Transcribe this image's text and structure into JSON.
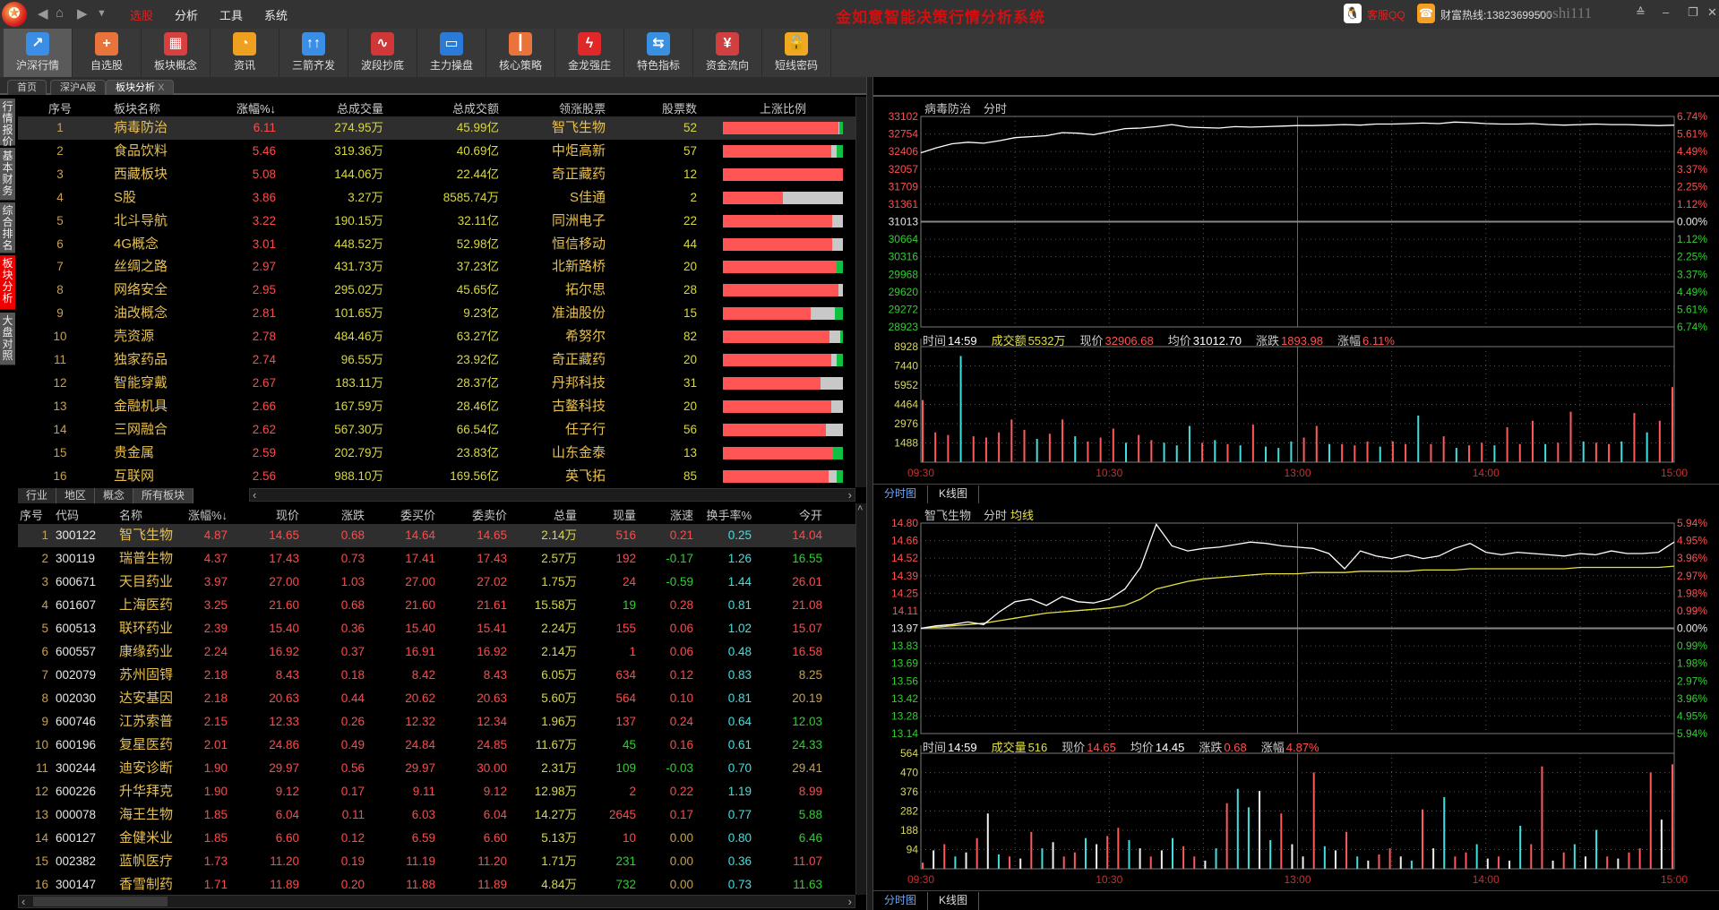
{
  "app": {
    "title": "金如意智能决策行情分析系统",
    "logo": "如意",
    "service_qq": "客服QQ",
    "hotline": "财富热线:13823699500",
    "user": "ceshi111"
  },
  "menu": [
    "选股",
    "分析",
    "工具",
    "系统"
  ],
  "toolbar": [
    {
      "label": "沪深行情",
      "icon": "chart-up-icon",
      "glyph": "↗",
      "color": "#3a8ee6"
    },
    {
      "label": "自选股",
      "icon": "plus-icon",
      "glyph": "+",
      "color": "#e8743b"
    },
    {
      "label": "板块概念",
      "icon": "grid-icon",
      "glyph": "▦",
      "color": "#d84040"
    },
    {
      "label": "资讯",
      "icon": "rss-icon",
      "glyph": "◔",
      "color": "#f0a020"
    },
    {
      "label": "三箭齐发",
      "icon": "arrows-up-icon",
      "glyph": "↑↑",
      "color": "#3a8ee6"
    },
    {
      "label": "波段抄底",
      "icon": "wave-icon",
      "glyph": "∿",
      "color": "#d03838"
    },
    {
      "label": "主力操盘",
      "icon": "monitor-chart-icon",
      "glyph": "▭",
      "color": "#2a7ad8"
    },
    {
      "label": "核心策略",
      "icon": "candles-icon",
      "glyph": "┃",
      "color": "#e8743b"
    },
    {
      "label": "金龙强庄",
      "icon": "zigzag-icon",
      "glyph": "ϟ",
      "color": "#e02828"
    },
    {
      "label": "特色指标",
      "icon": "signpost-icon",
      "glyph": "⇆",
      "color": "#3a90e0"
    },
    {
      "label": "资金流向",
      "icon": "money-icon",
      "glyph": "¥",
      "color": "#d04040"
    },
    {
      "label": "短线密码",
      "icon": "lock-icon",
      "glyph": "🔓",
      "color": "#f0a820"
    }
  ],
  "page_tabs": [
    "首页",
    "深沪A股",
    "板块分析"
  ],
  "page_tab_close": "X",
  "side_tabs": [
    "行情报价",
    "基本财务",
    "综合排名",
    "板块分析",
    "大盘对照"
  ],
  "sector_table": {
    "headers": [
      "序号",
      "板块名称",
      "涨幅%↓",
      "总成交量",
      "总成交额",
      "领涨股票",
      "股票数",
      "上涨比例"
    ],
    "rows": [
      [
        "1",
        "病毒防治",
        "6.11",
        "274.95万",
        "45.99亿",
        "智飞生物",
        "52"
      ],
      [
        "2",
        "食品饮料",
        "5.46",
        "319.36万",
        "40.69亿",
        "中炬高新",
        "57"
      ],
      [
        "3",
        "西藏板块",
        "5.08",
        "144.06万",
        "22.44亿",
        "奇正藏药",
        "12"
      ],
      [
        "4",
        "S股",
        "3.86",
        "3.27万",
        "8585.74万",
        "S佳通",
        "2"
      ],
      [
        "5",
        "北斗导航",
        "3.22",
        "190.15万",
        "32.11亿",
        "同洲电子",
        "22"
      ],
      [
        "6",
        "4G概念",
        "3.01",
        "448.52万",
        "52.98亿",
        "恒信移动",
        "44"
      ],
      [
        "7",
        "丝绸之路",
        "2.97",
        "431.73万",
        "37.23亿",
        "北新路桥",
        "20"
      ],
      [
        "8",
        "网络安全",
        "2.95",
        "295.02万",
        "45.65亿",
        "拓尔思",
        "28"
      ],
      [
        "9",
        "油改概念",
        "2.81",
        "101.65万",
        "9.23亿",
        "准油股份",
        "15"
      ],
      [
        "10",
        "壳资源",
        "2.78",
        "484.46万",
        "63.27亿",
        "希努尔",
        "82"
      ],
      [
        "11",
        "独家药品",
        "2.74",
        "96.55万",
        "23.92亿",
        "奇正藏药",
        "20"
      ],
      [
        "12",
        "智能穿戴",
        "2.67",
        "183.11万",
        "28.37亿",
        "丹邦科技",
        "31"
      ],
      [
        "13",
        "金融机具",
        "2.66",
        "167.59万",
        "28.46亿",
        "古鳌科技",
        "20"
      ],
      [
        "14",
        "三网融合",
        "2.62",
        "567.30万",
        "66.54亿",
        "任子行",
        "56"
      ],
      [
        "15",
        "贵金属",
        "2.59",
        "202.79万",
        "23.83亿",
        "山东金泰",
        "13"
      ],
      [
        "16",
        "互联网",
        "2.56",
        "988.10万",
        "169.56亿",
        "英飞拓",
        "85"
      ]
    ],
    "ratios": [
      [
        0.96,
        0.01,
        0.03
      ],
      [
        0.9,
        0.05,
        0.05
      ],
      [
        1,
        0,
        0
      ],
      [
        0.5,
        0.5,
        0
      ],
      [
        0.91,
        0.09,
        0
      ],
      [
        0.91,
        0.09,
        0
      ],
      [
        0.95,
        0,
        0.05
      ],
      [
        0.96,
        0.04,
        0
      ],
      [
        0.73,
        0.2,
        0.07
      ],
      [
        0.89,
        0.09,
        0.02
      ],
      [
        0.9,
        0.05,
        0.05
      ],
      [
        0.81,
        0.19,
        0
      ],
      [
        0.9,
        0.1,
        0
      ],
      [
        0.86,
        0.14,
        0
      ],
      [
        0.92,
        0,
        0.08
      ],
      [
        0.88,
        0.07,
        0.05
      ]
    ]
  },
  "sector_tabs": [
    "行业",
    "地区",
    "概念",
    "所有板块"
  ],
  "stock_table": {
    "headers": [
      "序号",
      "代码",
      "名称",
      "涨幅%↓",
      "现价",
      "涨跌",
      "委买价",
      "委卖价",
      "总量",
      "现量",
      "涨速",
      "换手率%",
      "今开"
    ],
    "rows": [
      [
        "1",
        "300122",
        "智飞生物",
        "4.87",
        "14.65",
        "0.68",
        "14.64",
        "14.65",
        "2.14万",
        "516",
        "0.21",
        "0.25",
        "14.04"
      ],
      [
        "2",
        "300119",
        "瑞普生物",
        "4.37",
        "17.43",
        "0.73",
        "17.41",
        "17.43",
        "2.57万",
        "192",
        "-0.17",
        "1.26",
        "16.55"
      ],
      [
        "3",
        "600671",
        "天目药业",
        "3.97",
        "27.00",
        "1.03",
        "27.00",
        "27.02",
        "1.75万",
        "24",
        "-0.59",
        "1.44",
        "26.01"
      ],
      [
        "4",
        "601607",
        "上海医药",
        "3.25",
        "21.60",
        "0.68",
        "21.60",
        "21.61",
        "15.58万",
        "19",
        "0.28",
        "0.81",
        "21.08"
      ],
      [
        "5",
        "600513",
        "联环药业",
        "2.39",
        "15.40",
        "0.36",
        "15.40",
        "15.41",
        "2.24万",
        "155",
        "0.06",
        "1.02",
        "15.07"
      ],
      [
        "6",
        "600557",
        "康缘药业",
        "2.24",
        "16.92",
        "0.37",
        "16.91",
        "16.92",
        "2.14万",
        "1",
        "0.06",
        "0.48",
        "16.58"
      ],
      [
        "7",
        "002079",
        "苏州固锝",
        "2.18",
        "8.43",
        "0.18",
        "8.42",
        "8.43",
        "6.05万",
        "634",
        "0.12",
        "0.83",
        "8.25"
      ],
      [
        "8",
        "002030",
        "达安基因",
        "2.18",
        "20.63",
        "0.44",
        "20.62",
        "20.63",
        "5.60万",
        "564",
        "0.10",
        "0.81",
        "20.19"
      ],
      [
        "9",
        "600746",
        "江苏索普",
        "2.15",
        "12.33",
        "0.26",
        "12.32",
        "12.34",
        "1.96万",
        "137",
        "0.24",
        "0.64",
        "12.03"
      ],
      [
        "10",
        "600196",
        "复星医药",
        "2.01",
        "24.86",
        "0.49",
        "24.84",
        "24.85",
        "11.67万",
        "45",
        "0.16",
        "0.61",
        "24.33"
      ],
      [
        "11",
        "300244",
        "迪安诊断",
        "1.90",
        "29.97",
        "0.56",
        "29.97",
        "30.00",
        "2.31万",
        "109",
        "-0.03",
        "0.70",
        "29.41"
      ],
      [
        "12",
        "600226",
        "升华拜克",
        "1.90",
        "9.12",
        "0.17",
        "9.11",
        "9.12",
        "12.98万",
        "2",
        "0.22",
        "1.19",
        "8.99"
      ],
      [
        "13",
        "000078",
        "海王生物",
        "1.85",
        "6.04",
        "0.11",
        "6.03",
        "6.04",
        "14.27万",
        "2645",
        "0.17",
        "0.77",
        "5.88"
      ],
      [
        "14",
        "600127",
        "金健米业",
        "1.85",
        "6.60",
        "0.12",
        "6.59",
        "6.60",
        "5.13万",
        "10",
        "0.00",
        "0.80",
        "6.46"
      ],
      [
        "15",
        "002382",
        "蓝帆医疗",
        "1.73",
        "11.20",
        "0.19",
        "11.19",
        "11.20",
        "1.71万",
        "231",
        "0.00",
        "0.36",
        "11.07"
      ],
      [
        "16",
        "300147",
        "香雪制药",
        "1.71",
        "11.89",
        "0.20",
        "11.88",
        "11.89",
        "4.84万",
        "732",
        "0.00",
        "0.73",
        "11.63"
      ]
    ],
    "cell_colors": [
      "rrr",
      "rgg",
      "rgr",
      "grr",
      "rrr",
      "rrr",
      "rrn",
      "rrn",
      "rrg",
      "grg",
      "ggn",
      "rrr",
      "rrg",
      "rng",
      "gnr",
      "gng"
    ]
  },
  "chart_tabs": [
    "分时图",
    "K线图"
  ],
  "chart_data": [
    {
      "type": "line",
      "title": "病毒防治",
      "mode": "分时",
      "base": 31013,
      "price_ticks": [
        "33102",
        "32754",
        "32406",
        "32057",
        "31709",
        "31361",
        "31013",
        "30664",
        "30316",
        "29968",
        "29620",
        "29272",
        "28923"
      ],
      "pct_ticks": [
        "6.74%",
        "5.61%",
        "4.49%",
        "3.37%",
        "2.25%",
        "1.12%",
        "0.00%",
        "1.12%",
        "2.25%",
        "3.37%",
        "4.49%",
        "5.61%",
        "6.74%"
      ],
      "ylim": [
        28923,
        33102
      ],
      "info": [
        [
          "时间",
          "14:59"
        ],
        [
          "成交额",
          "5532万"
        ],
        [
          "现价",
          "32906.68"
        ],
        [
          "均价",
          "31012.70"
        ],
        [
          "涨跌",
          "1893.98"
        ],
        [
          "涨幅",
          "6.11%"
        ]
      ],
      "price": [
        32380,
        32480,
        32560,
        32590,
        32570,
        32620,
        32680,
        32700,
        32720,
        32780,
        32770,
        32740,
        32800,
        32860,
        32870,
        32900,
        32940,
        32890,
        32880,
        32870,
        32900,
        32890,
        32900,
        32910,
        32920,
        32920,
        32930,
        32940,
        32930,
        32950,
        32950,
        32960,
        32970,
        32960,
        32990,
        32980,
        32960,
        32950,
        32950,
        32960,
        32940,
        32930,
        32940,
        32950,
        32940,
        32940,
        32930,
        32920,
        32930
      ],
      "vol_ticks": [
        "8928",
        "7440",
        "5952",
        "4464",
        "2976",
        "1488"
      ],
      "vol_max": 8928,
      "volume": [
        4800,
        2300,
        2100,
        8200,
        2000,
        1900,
        2300,
        3300,
        2500,
        1800,
        2200,
        3300,
        2000,
        1600,
        1900,
        2600,
        1500,
        2100,
        1700,
        1500,
        1300,
        2800,
        1500,
        1700,
        1400,
        1300,
        2900,
        1200,
        1100,
        1600,
        1900,
        2800,
        1400,
        1400,
        1300,
        1600,
        1200,
        1600,
        1400,
        3600,
        1400,
        2000,
        1100,
        1300,
        1500,
        1300,
        2700,
        1400,
        3200,
        1400,
        1500,
        3900,
        1600,
        1500,
        1400,
        1600,
        3800,
        2300,
        3200,
        5800
      ],
      "vol_colors": "rrrcrrrrrcrrcrrrcrrcccrcrcrcccrrcrrrcrrcrrcrrcrrrcrrcrrcrcrr",
      "time_ticks": [
        "09:30",
        "10:30",
        "13:00",
        "14:00",
        "15:00"
      ]
    },
    {
      "type": "line",
      "title": "智飞生物",
      "mode": "分时",
      "avg_label": "均线",
      "base": 13.97,
      "price_ticks": [
        "14.80",
        "14.66",
        "14.52",
        "14.39",
        "14.25",
        "14.11",
        "13.97",
        "13.83",
        "13.69",
        "13.56",
        "13.42",
        "13.28",
        "13.14"
      ],
      "pct_ticks": [
        "5.94%",
        "4.95%",
        "3.96%",
        "2.97%",
        "1.98%",
        "0.99%",
        "0.00%",
        "0.99%",
        "1.98%",
        "2.97%",
        "3.96%",
        "4.95%",
        "5.94%"
      ],
      "ylim": [
        13.14,
        14.8
      ],
      "info": [
        [
          "时间",
          "14:59"
        ],
        [
          "成交量",
          "516"
        ],
        [
          "现价",
          "14.65"
        ],
        [
          "均价",
          "14.45"
        ],
        [
          "涨跌",
          "0.68"
        ],
        [
          "涨幅",
          "4.87%"
        ]
      ],
      "price": [
        13.97,
        13.99,
        14.0,
        14.02,
        14.0,
        14.1,
        14.18,
        14.2,
        14.15,
        14.22,
        14.18,
        14.17,
        14.2,
        14.28,
        14.45,
        14.79,
        14.62,
        14.58,
        14.6,
        14.61,
        14.63,
        14.65,
        14.64,
        14.62,
        14.61,
        14.6,
        14.56,
        14.44,
        14.58,
        14.54,
        14.52,
        14.55,
        14.52,
        14.54,
        14.6,
        14.64,
        14.57,
        14.55,
        14.57,
        14.56,
        14.55,
        14.54,
        14.56,
        14.55,
        14.58,
        14.56,
        14.56,
        14.57,
        14.65
      ],
      "avg": [
        13.97,
        13.98,
        13.99,
        14.0,
        14.01,
        14.03,
        14.05,
        14.07,
        14.09,
        14.1,
        14.11,
        14.12,
        14.13,
        14.15,
        14.2,
        14.28,
        14.31,
        14.34,
        14.36,
        14.37,
        14.38,
        14.39,
        14.4,
        14.4,
        14.4,
        14.41,
        14.41,
        14.41,
        14.42,
        14.42,
        14.42,
        14.42,
        14.43,
        14.43,
        14.43,
        14.44,
        14.44,
        14.44,
        14.44,
        14.44,
        14.44,
        14.44,
        14.45,
        14.45,
        14.45,
        14.45,
        14.45,
        14.45,
        14.46
      ],
      "vol_ticks": [
        "564",
        "470",
        "376",
        "282",
        "188",
        "94"
      ],
      "vol_max": 564,
      "volume": [
        30,
        90,
        120,
        60,
        80,
        150,
        270,
        70,
        60,
        50,
        180,
        100,
        130,
        60,
        80,
        150,
        120,
        160,
        200,
        140,
        100,
        60,
        90,
        150,
        110,
        60,
        40,
        100,
        320,
        390,
        300,
        380,
        140,
        270,
        120,
        60,
        470,
        110,
        90,
        180,
        60,
        40,
        70,
        100,
        60,
        40,
        290,
        100,
        350,
        60,
        80,
        120,
        50,
        60,
        40,
        210,
        120,
        500,
        40,
        80,
        120,
        60,
        190,
        60,
        50,
        80,
        100,
        470,
        240,
        510
      ],
      "vol_colors": "rwrcwrwcrwrcwrrcwrrcwrwcrrwcrccwcrwwrcwrcwrrwcrwcrrcwrwcrrwrcwcrwrrrw",
      "time_ticks": [
        "09:30",
        "10:30",
        "13:00",
        "14:00",
        "15:00"
      ]
    }
  ]
}
